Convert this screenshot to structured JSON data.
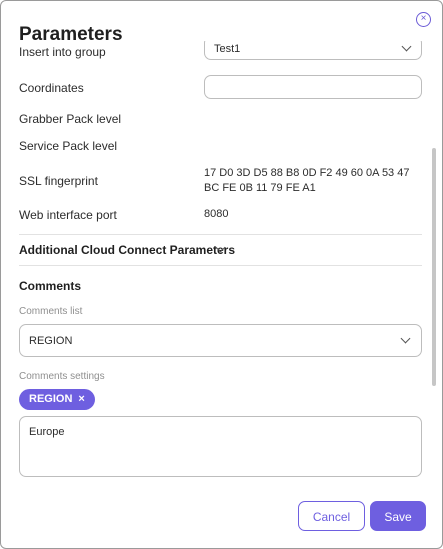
{
  "dialog": {
    "title": "Parameters",
    "close_label": "×"
  },
  "fields": {
    "insert_into_group": {
      "label": "Insert into group",
      "value": "Test1"
    },
    "coordinates": {
      "label": "Coordinates",
      "value": ""
    },
    "grabber_pack_level": {
      "label": "Grabber Pack level"
    },
    "service_pack_level": {
      "label": "Service Pack level"
    },
    "ssl_fingerprint": {
      "label": "SSL fingerprint",
      "line1": "17 D0 3D D5 88 B8 0D F2 49 60 0A 53 47",
      "line2": "BC FE 0B 11 79 FE A1"
    },
    "web_interface_port": {
      "label": "Web interface port",
      "value": "8080"
    }
  },
  "additional": {
    "label": "Additional Cloud Connect Parameters"
  },
  "comments": {
    "heading": "Comments",
    "list_label": "Comments list",
    "list_value": "REGION",
    "settings_label": "Comments settings",
    "chip_label": "REGION",
    "chip_remove": "×",
    "textarea_value": "Europe"
  },
  "buttons": {
    "cancel": "Cancel",
    "save": "Save"
  },
  "colors": {
    "accent": "#6e5fe0",
    "border": "#bdbdbd"
  }
}
